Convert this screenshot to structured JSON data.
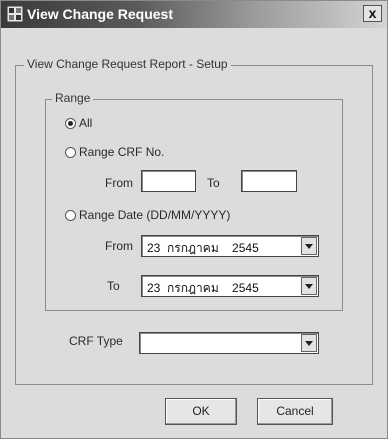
{
  "window": {
    "title": "View Change Request",
    "close_label": "x"
  },
  "setup_group": {
    "title": "View Change Request Report - Setup"
  },
  "range_group": {
    "title": "Range",
    "options": [
      {
        "label": "All",
        "checked": true
      },
      {
        "label": "Range CRF No.",
        "checked": false
      },
      {
        "label": "Range Date (DD/MM/YYYY)",
        "checked": false
      }
    ],
    "crf_from_label": "From",
    "crf_to_label": "To",
    "crf_from_value": "",
    "crf_to_value": "",
    "date_from_label": "From",
    "date_to_label": "To",
    "date_from_value": "23  กรกฎาคม    2545",
    "date_to_value": "23  กรกฎาคม    2545"
  },
  "crf_type": {
    "label": "CRF Type",
    "value": ""
  },
  "buttons": {
    "ok": "OK",
    "cancel": "Cancel"
  }
}
